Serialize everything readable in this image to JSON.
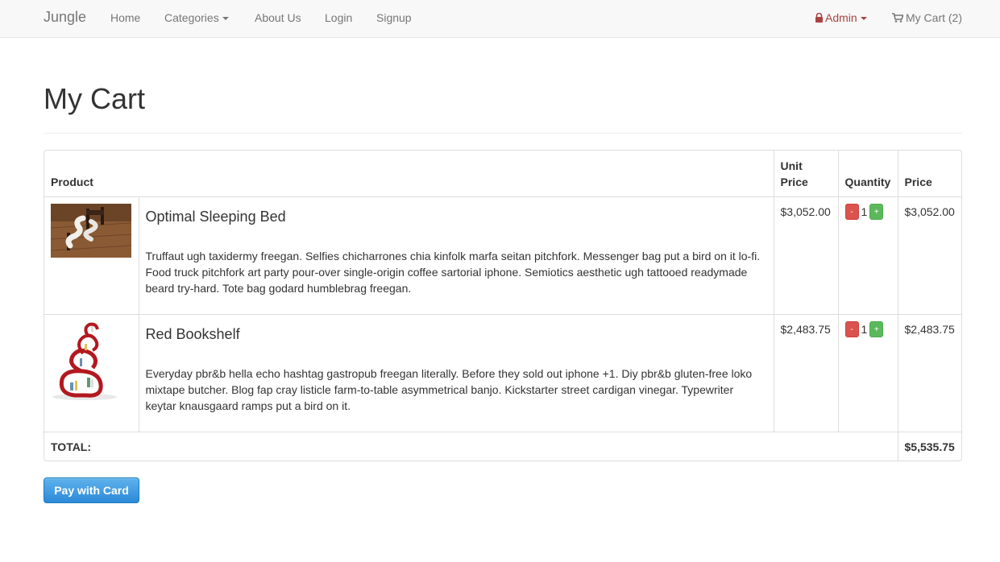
{
  "navbar": {
    "brand": "Jungle",
    "links": {
      "home": "Home",
      "categories": "Categories",
      "about": "About Us",
      "login": "Login",
      "signup": "Signup"
    },
    "admin": "Admin",
    "cart": "My Cart (2)"
  },
  "page": {
    "title": "My Cart"
  },
  "table": {
    "headers": {
      "product": "Product",
      "unit_price": "Unit Price",
      "quantity": "Quantity",
      "price": "Price"
    },
    "rows": [
      {
        "name": "Optimal Sleeping Bed",
        "description": "Truffaut ugh taxidermy freegan. Selfies chicharrones chia kinfolk marfa seitan pitchfork. Messenger bag put a bird on it lo-fi. Food truck pitchfork art party pour-over single-origin coffee sartorial iphone. Semiotics aesthetic ugh tattooed readymade beard try-hard. Tote bag godard humblebrag freegan.",
        "unit_price": "$3,052.00",
        "quantity": "1",
        "price": "$3,052.00",
        "minus": "-",
        "plus": "+"
      },
      {
        "name": "Red Bookshelf",
        "description": "Everyday pbr&b hella echo hashtag gastropub freegan literally. Before they sold out iphone +1. Diy pbr&b gluten-free loko mixtape butcher. Blog fap cray listicle farm-to-table asymmetrical banjo. Kickstarter street cardigan vinegar. Typewriter keytar knausgaard ramps put a bird on it.",
        "unit_price": "$2,483.75",
        "quantity": "1",
        "price": "$2,483.75",
        "minus": "-",
        "plus": "+"
      }
    ],
    "total_label": "TOTAL:",
    "total_value": "$5,535.75"
  },
  "pay_button": "Pay with Card",
  "colors": {
    "navbar_bg": "#f8f8f8",
    "link": "#777777",
    "admin": "#a94442",
    "minus_btn": "#d9534f",
    "plus_btn": "#5cb85c",
    "pay_btn": "#3a9ae0"
  },
  "icons": {
    "admin": "lock-icon",
    "cart": "shopping-cart-icon",
    "dropdown": "caret-down-icon"
  }
}
